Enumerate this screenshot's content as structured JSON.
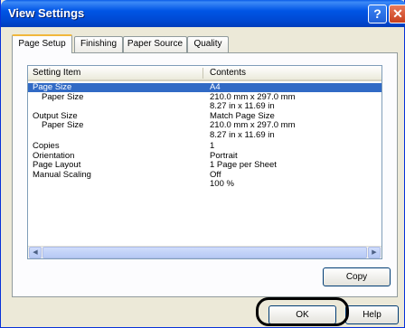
{
  "window": {
    "title": "View Settings",
    "help_button": "?",
    "close_button": "✕"
  },
  "tabs": [
    {
      "label": "Page Setup"
    },
    {
      "label": "Finishing"
    },
    {
      "label": "Paper Source"
    },
    {
      "label": "Quality"
    }
  ],
  "list": {
    "headers": {
      "item": "Setting Item",
      "contents": "Contents"
    },
    "rows": [
      {
        "item": "Page Size",
        "contents": "A4"
      },
      {
        "item": "Paper Size",
        "contents": "210.0 mm x 297.0 mm"
      },
      {
        "item": "",
        "contents": "8.27 in x 11.69 in"
      },
      {
        "item": "Output Size",
        "contents": "Match Page Size"
      },
      {
        "item": "Paper Size",
        "contents": "210.0 mm x 297.0 mm"
      },
      {
        "item": "",
        "contents": "8.27 in x 11.69 in"
      },
      {
        "item": "Copies",
        "contents": "1"
      },
      {
        "item": "Orientation",
        "contents": "Portrait"
      },
      {
        "item": "Page Layout",
        "contents": "1 Page per Sheet"
      },
      {
        "item": "Manual Scaling",
        "contents": "Off"
      },
      {
        "item": "",
        "contents": "100 %"
      }
    ]
  },
  "buttons": {
    "copy": "Copy",
    "ok": "OK",
    "help": "Help"
  }
}
